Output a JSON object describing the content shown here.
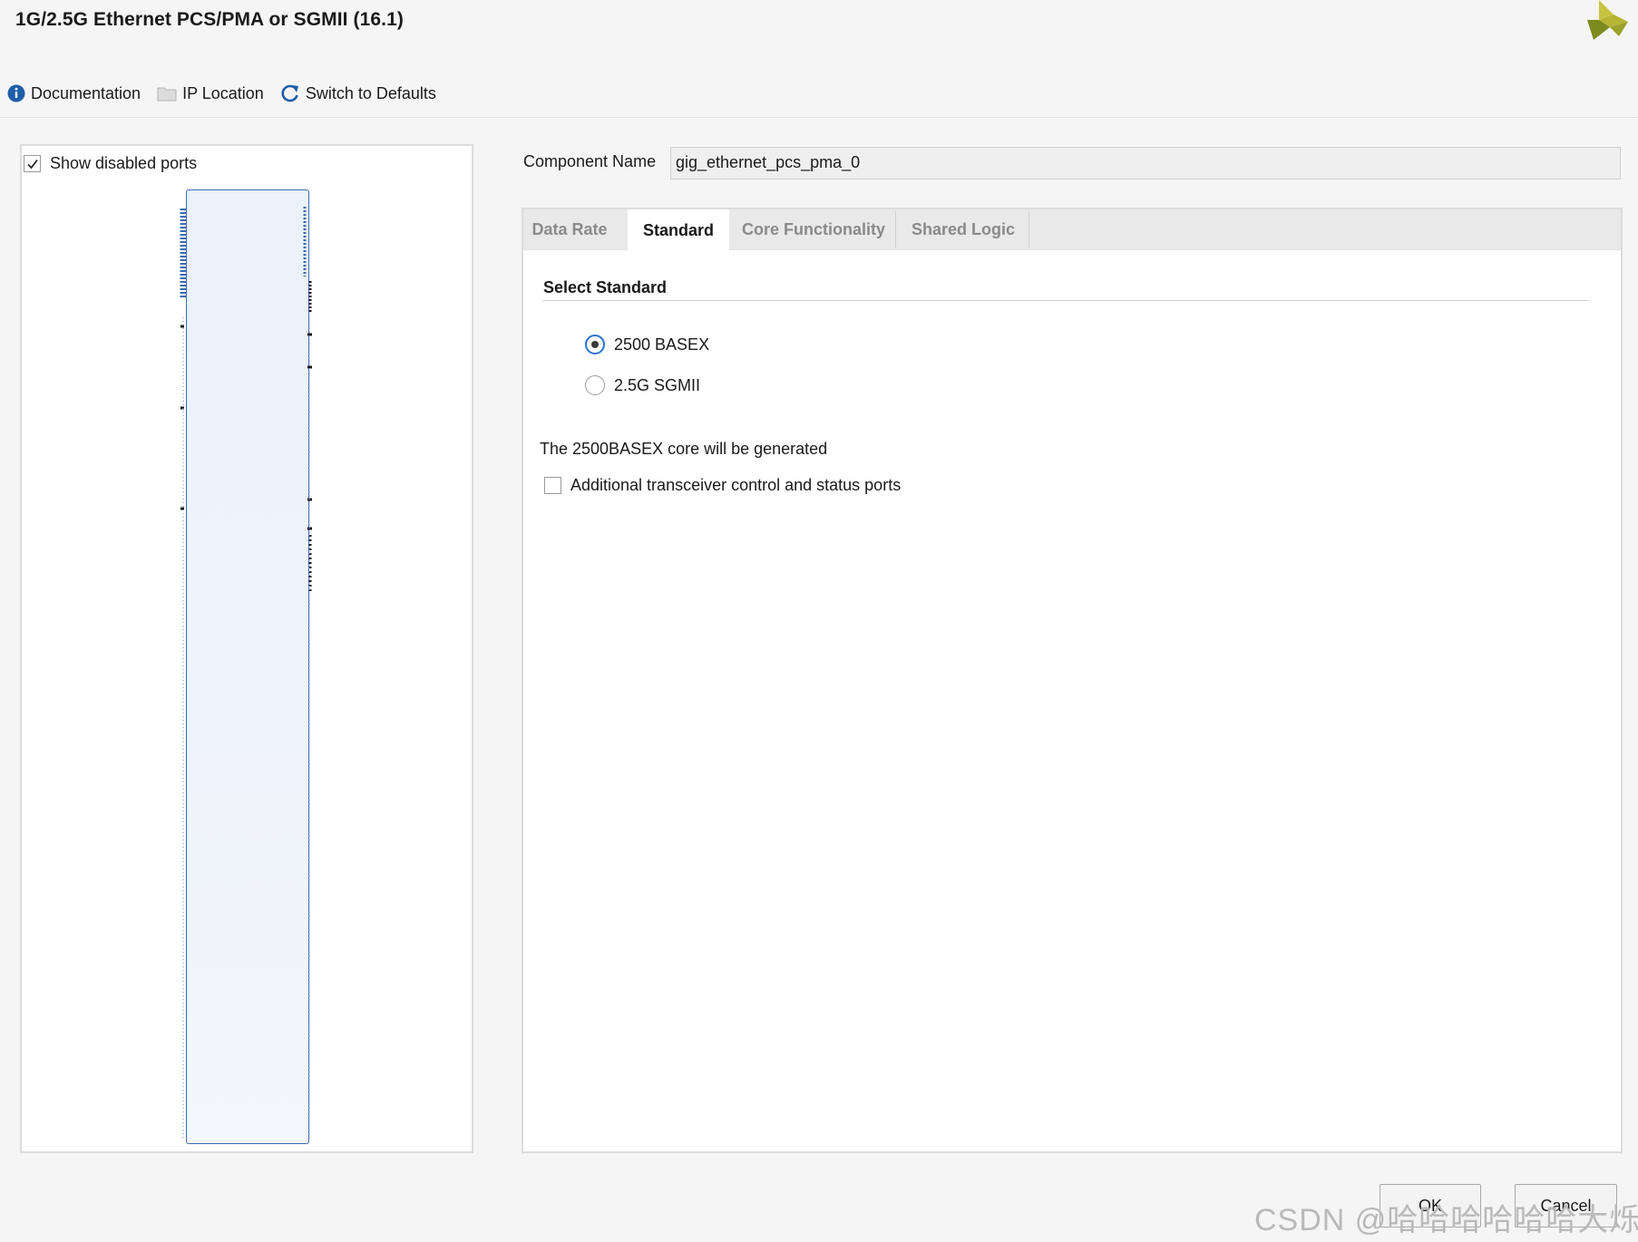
{
  "window": {
    "title": "1G/2.5G Ethernet PCS/PMA or SGMII (16.1)",
    "logo_icon": "xilinx-logo-icon"
  },
  "toolbar": {
    "documentation": "Documentation",
    "ip_location": "IP Location",
    "switch_defaults": "Switch to Defaults"
  },
  "left_panel": {
    "show_disabled_ports": "Show disabled ports",
    "show_disabled_checked": true
  },
  "component": {
    "label": "Component Name",
    "value": "gig_ethernet_pcs_pma_0"
  },
  "tabs": [
    {
      "label": "Data Rate",
      "active": false
    },
    {
      "label": "Standard",
      "active": true
    },
    {
      "label": "Core Functionality",
      "active": false
    },
    {
      "label": "Shared Logic",
      "active": false
    }
  ],
  "standard": {
    "section_title": "Select Standard",
    "options": [
      {
        "label": "2500 BASEX",
        "selected": true
      },
      {
        "label": "2.5G SGMII",
        "selected": false
      }
    ],
    "note": "The 2500BASEX core will be generated",
    "additional_ports_label": "Additional transceiver control and status ports",
    "additional_ports_checked": false
  },
  "buttons": {
    "ok": "OK",
    "cancel": "Cancel"
  },
  "watermark": "CSDN @哈哈哈哈哈哈大烁",
  "colors": {
    "accent": "#2e73c9",
    "symbol_border": "#3c6ab0",
    "logo_primary": "#b8b535",
    "logo_secondary": "#7c8a1e"
  }
}
